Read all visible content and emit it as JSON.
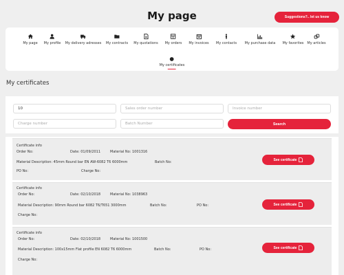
{
  "header": {
    "title": "My page",
    "suggestions_label": "Suggestions?.. let us know"
  },
  "nav": {
    "items": [
      {
        "label": "My page",
        "icon": "home-icon"
      },
      {
        "label": "My profile",
        "icon": "user-icon"
      },
      {
        "label": "My delivery adresses",
        "icon": "truck-icon"
      },
      {
        "label": "My contracts",
        "icon": "folder-icon"
      },
      {
        "label": "My quotations",
        "icon": "document-icon"
      },
      {
        "label": "My orders",
        "icon": "grid-icon"
      },
      {
        "label": "My invoices",
        "icon": "calendar-icon"
      },
      {
        "label": "My contacts",
        "icon": "person-icon"
      },
      {
        "label": "My purchase data",
        "icon": "bar-chart-icon"
      },
      {
        "label": "My favorites",
        "icon": "star-icon"
      },
      {
        "label": "My articles",
        "icon": "link-icon"
      }
    ],
    "active": {
      "label": "My certificates",
      "icon": "certificate-icon"
    }
  },
  "section_title": "My certificates",
  "filters": {
    "field1_value": "10",
    "sales_order_placeholder": "Sales order number",
    "invoice_placeholder": "Invoice number",
    "charge_placeholder": "Charge number",
    "batch_placeholder": "Batch Number",
    "search_label": "Search"
  },
  "certificates": [
    {
      "heading": "Certificate info",
      "order": "Order No:",
      "date": "Date: 01/09/2011",
      "material_no": "Material No: 1001316",
      "description": "Material Description: 45mm Round bar EN AW-6082 T6 6000mm",
      "batch": "Batch No:",
      "po": "PO No:",
      "charge": "Charge No:",
      "button": "See certificate"
    },
    {
      "heading": "Certificate info",
      "order": "Order No:",
      "date": "Date: 02/10/2018",
      "material_no": "Material No: 1038963",
      "description": "Material Description: 90mm Round bar 6082 T6/T651 3000mm",
      "batch": "Batch No:",
      "po": "PO No:",
      "charge": "Charge No:",
      "button": "See certificate"
    },
    {
      "heading": "Certificate info",
      "order": "Order No:",
      "date": "Date: 02/10/2018",
      "material_no": "Material No: 1001500",
      "description": "Material Description: 100x15mm Flat profile EN 6082 T6 6000mm",
      "batch": "Batch No:",
      "po": "PO No:",
      "charge": "Charge No:",
      "button": "See certificate"
    }
  ],
  "colors": {
    "accent": "#e5233b",
    "background": "#efefef"
  }
}
